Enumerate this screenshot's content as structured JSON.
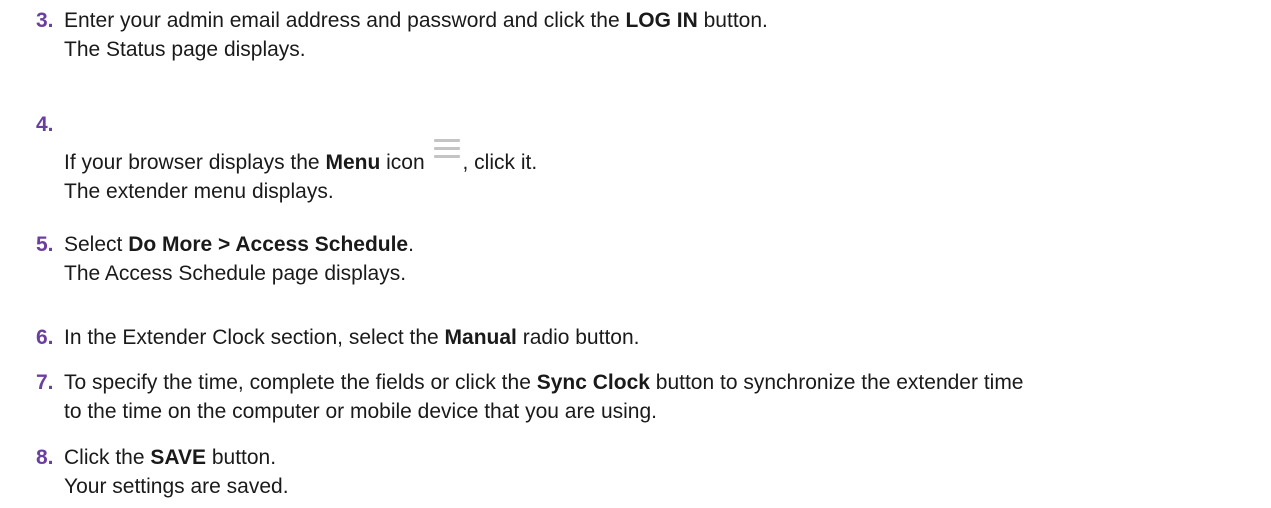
{
  "steps": [
    {
      "number": "3.",
      "pre": "Enter your admin email address and password and click the ",
      "bold": "LOG IN",
      "post": " button.",
      "result": "The Status page displays."
    },
    {
      "number": "4.",
      "pre": "If your browser displays the ",
      "bold": "Menu",
      "mid": " icon ",
      "icon": "menu-icon",
      "post": ", click it.",
      "result": "The extender menu displays."
    },
    {
      "number": "5.",
      "pre": "Select ",
      "bold": "Do More > Access Schedule",
      "post": ".",
      "result": "The Access Schedule page displays."
    },
    {
      "number": "6.",
      "pre": "In the Extender Clock section, select the ",
      "bold": "Manual",
      "post": " radio button."
    },
    {
      "number": "7.",
      "pre": "To specify the time, complete the fields or click the ",
      "bold": "Sync Clock",
      "post": " button to synchronize the extender time",
      "continuation": "to the time on the computer or mobile device that you are using."
    },
    {
      "number": "8.",
      "pre": "Click the ",
      "bold": "SAVE",
      "post": " button.",
      "result": "Your settings are saved."
    }
  ],
  "colors": {
    "step_number": "#6b3fa0",
    "text": "#1a1a1a",
    "icon": "#c4c4c4"
  }
}
